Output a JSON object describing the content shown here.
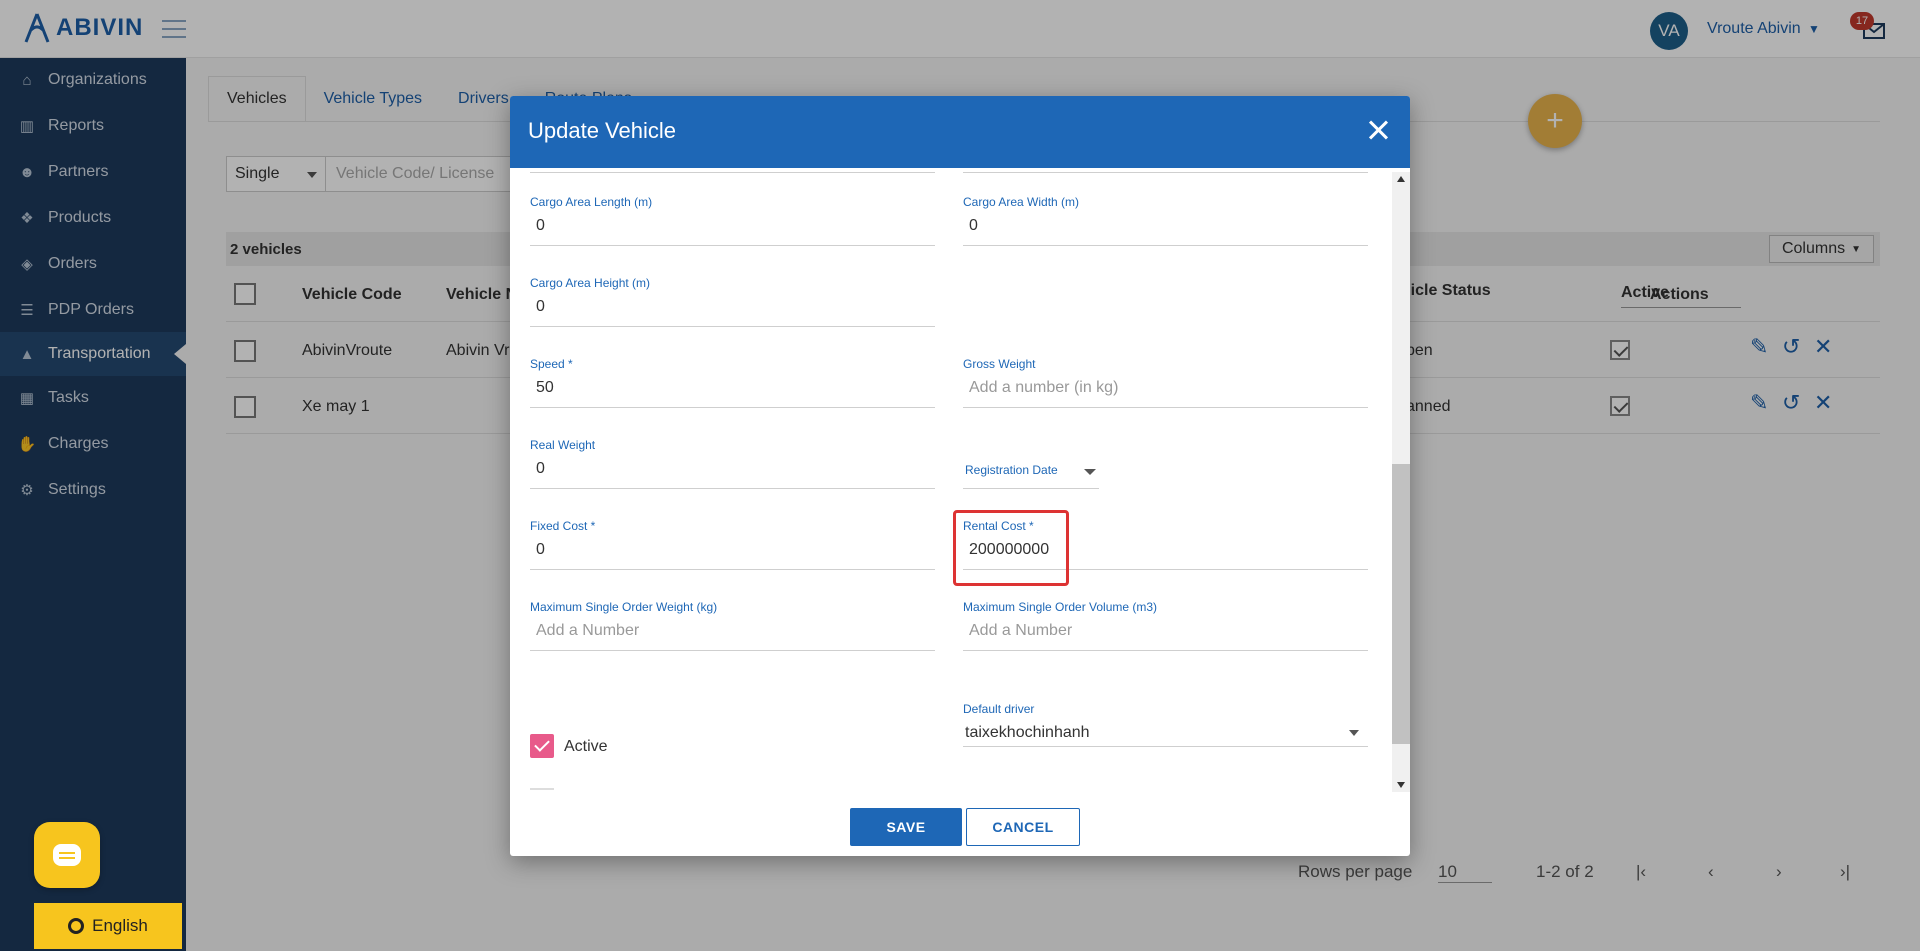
{
  "app": {
    "logo_text": "ABIVIN",
    "user_initials": "VA",
    "user_name": "Vroute Abivin",
    "mail_count": "17"
  },
  "sidebar": {
    "items": [
      {
        "label": "Organizations",
        "icon": "home-icon"
      },
      {
        "label": "Reports",
        "icon": "bar-chart-icon"
      },
      {
        "label": "Partners",
        "icon": "users-icon"
      },
      {
        "label": "Products",
        "icon": "dropbox-icon"
      },
      {
        "label": "Orders",
        "icon": "cubes-icon"
      },
      {
        "label": "PDP Orders",
        "icon": "list-icon"
      },
      {
        "label": "Transportation",
        "icon": "road-icon"
      },
      {
        "label": "Tasks",
        "icon": "calendar-icon"
      },
      {
        "label": "Charges",
        "icon": "hand-money-icon"
      },
      {
        "label": "Settings",
        "icon": "gear-icon"
      }
    ],
    "active_index": 6,
    "language": "English"
  },
  "page": {
    "tabs": [
      "Vehicles",
      "Vehicle Types",
      "Drivers",
      "Route Plans"
    ],
    "search_type": "Single",
    "search_placeholder": "Vehicle Code/ License",
    "count_label": "2 vehicles",
    "columns_label": "Columns",
    "headers": {
      "code": "Vehicle Code",
      "name": "Vehicle N",
      "status": "ehicle Status",
      "active_small": "Active",
      "active": "Active",
      "actions": "Actions"
    },
    "rows": [
      {
        "code": "AbivinVroute",
        "name": "Abivin Vr",
        "status": "pen"
      },
      {
        "code": "Xe may 1",
        "name": "",
        "status": "anned"
      }
    ],
    "pager": {
      "rows_per_page_label": "Rows per page",
      "rows_per_page": "10",
      "range": "1-2 of 2"
    }
  },
  "modal": {
    "title": "Update Vehicle",
    "fields": {
      "cargo_length": {
        "label": "Cargo Area Length (m)",
        "value": "0"
      },
      "cargo_width": {
        "label": "Cargo Area Width (m)",
        "value": "0"
      },
      "cargo_height": {
        "label": "Cargo Area Height (m)",
        "value": "0"
      },
      "speed": {
        "label": "Speed *",
        "value": "50"
      },
      "gross_weight": {
        "label": "Gross Weight",
        "placeholder": "Add a number (in kg)"
      },
      "real_weight": {
        "label": "Real Weight",
        "value": "0"
      },
      "registration_date": {
        "label": "Registration Date"
      },
      "fixed_cost": {
        "label": "Fixed Cost *",
        "value": "0"
      },
      "rental_cost": {
        "label": "Rental Cost *",
        "value": "200000000"
      },
      "max_order_weight": {
        "label": "Maximum Single Order Weight (kg)",
        "placeholder": "Add a Number"
      },
      "max_order_volume": {
        "label": "Maximum Single Order Volume (m3)",
        "placeholder": "Add a Number"
      },
      "default_driver": {
        "label": "Default driver",
        "value": "taixekhochinhanh"
      }
    },
    "active_label": "Active",
    "save_label": "SAVE",
    "cancel_label": "CANCEL"
  },
  "colors": {
    "primary": "#1e67b6",
    "sidebar": "#1d3a5c",
    "accent_yellow": "#f7c51e",
    "checkbox_pink": "#e85a8a",
    "highlight_red": "#dd3333"
  }
}
